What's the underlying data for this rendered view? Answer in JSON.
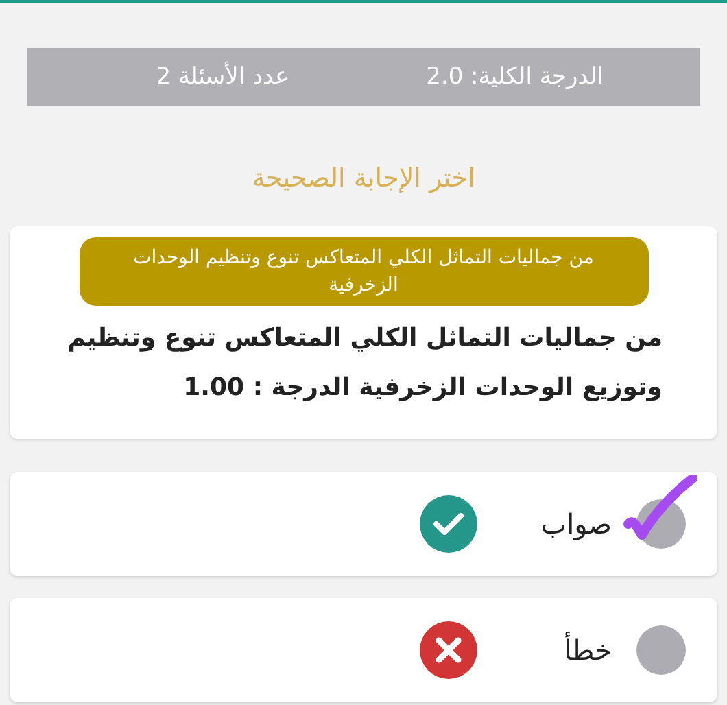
{
  "header": {
    "total_score": "الدرجة الكلية: 2.0",
    "question_count": "عدد الأسئلة 2"
  },
  "instruction": "اختر الإجابة الصحيحة",
  "question": {
    "text": "من جماليات التماثل الكلي المتعاكس تنوع وتنظيم وتوزيع الوحدات الزخرفية الدرجة : **1.00**",
    "translation_overlay": "من جماليات التماثل الكلي المتعاكس تنوع وتنظيم الوحدات الزخرفية"
  },
  "options": [
    {
      "label": "صواب",
      "kind": "correct",
      "selected": true
    },
    {
      "label": "خطأ",
      "kind": "wrong",
      "selected": false
    }
  ]
}
